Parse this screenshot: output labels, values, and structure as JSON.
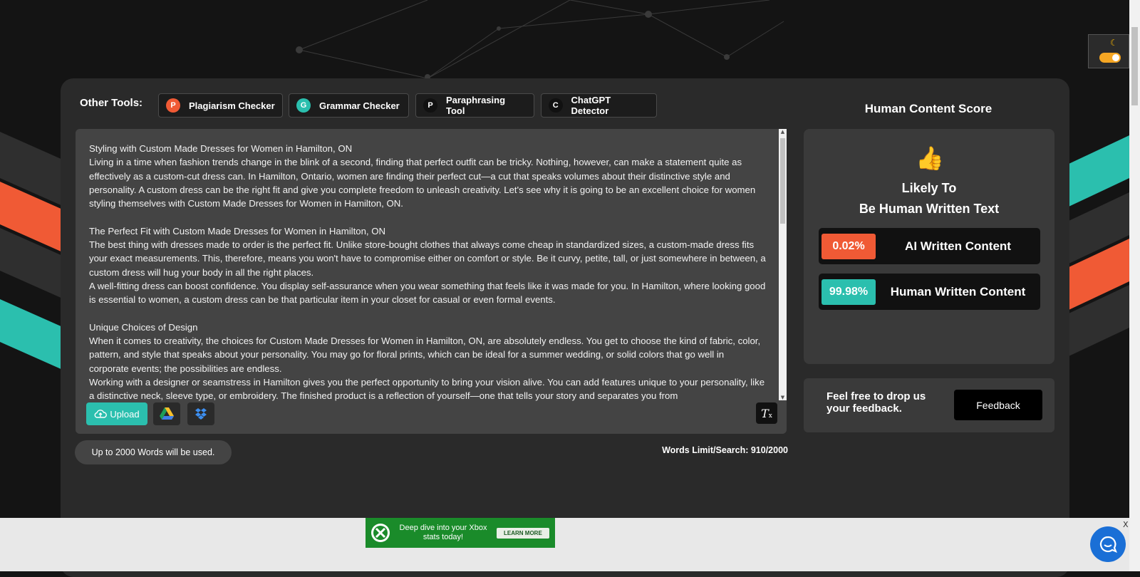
{
  "toolbar": {
    "label": "Other Tools:",
    "tools": [
      {
        "icon_letter": "P",
        "label": "Plagiarism Checker",
        "color": "#f05a35"
      },
      {
        "icon_letter": "G",
        "label": "Grammar Checker",
        "color": "#2bbfae"
      },
      {
        "icon_letter": "P",
        "label": "Paraphrasing Tool",
        "color": "#111111"
      },
      {
        "icon_letter": "C",
        "label": "ChatGPT Detector",
        "color": "#111111"
      }
    ]
  },
  "editor": {
    "text": "Styling with Custom Made Dresses for Women in Hamilton, ON\nLiving in a time when fashion trends change in the blink of a second, finding that perfect outfit can be tricky. Nothing, however, can make a statement quite as effectively as a custom-cut dress can. In Hamilton, Ontario, women are finding their perfect cut—a cut that speaks volumes about their distinctive style and personality. A custom dress can be the right fit and give you complete freedom to unleash creativity. Let's see why it is going to be an excellent choice for women styling themselves with Custom Made Dresses for Women in Hamilton, ON.\n\nThe Perfect Fit with Custom Made Dresses for Women in Hamilton, ON\nThe best thing with dresses made to order is the perfect fit. Unlike store-bought clothes that always come cheap in standardized sizes, a custom-made dress fits your exact measurements. This, therefore, means you won't have to compromise either on comfort or style. Be it curvy, petite, tall, or just somewhere in between, a custom dress will hug your body in all the right places.\nA well-fitting dress can boost confidence. You display self-assurance when you wear something that feels like it was made for you. In Hamilton, where looking good is essential to women, a custom dress can be that particular item in your closet for casual or even formal events.\n\nUnique Choices of Design\nWhen it comes to creativity, the choices for Custom Made Dresses for Women in Hamilton, ON, are absolutely endless. You get to choose the kind of fabric, color, pattern, and style that speaks about your personality. You may go for floral prints, which can be ideal for a summer wedding, or solid colors that go well in corporate events; the possibilities are endless.\nWorking with a designer or seamstress in Hamilton gives you the perfect opportunity to bring your vision alive. You can add features unique to your personality, like a distinctive neck, sleeve type, or embroidery. The finished product is a reflection of yourself—one that tells your story and separates you from",
    "upload_label": "Upload",
    "clear_glyph": "T"
  },
  "limits": {
    "words_note": "Up to 2000 Words will be used.",
    "words_limit": "Words Limit/Search: 910/2000"
  },
  "score": {
    "title": "Human Content Score",
    "verdict_line1": "Likely To",
    "verdict_line2": "Be Human Written Text",
    "ai_pct": "0.02%",
    "ai_label": "AI Written Content",
    "ai_color": "#f05a35",
    "human_pct": "99.98%",
    "human_label": "Human Written Content",
    "human_color": "#2bbfae"
  },
  "feedback": {
    "text": "Feel free to drop us your feedback.",
    "button": "Feedback"
  },
  "ad": {
    "text": "Deep dive into your Xbox stats today!",
    "button": "LEARN MORE",
    "close": "X"
  }
}
